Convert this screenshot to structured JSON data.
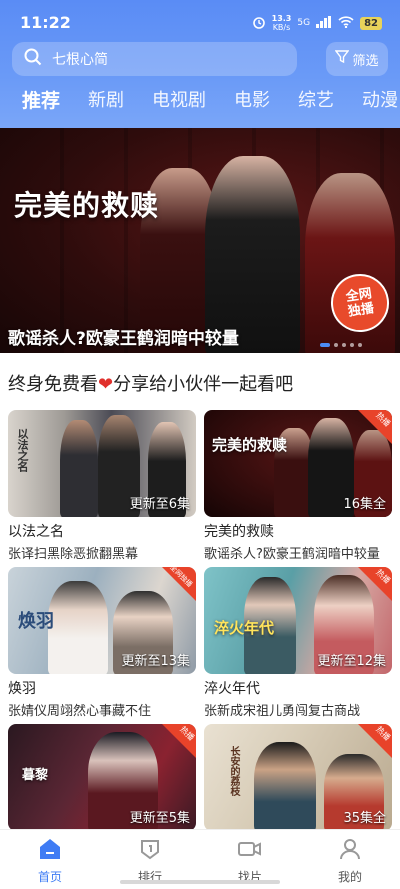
{
  "status_bar": {
    "time": "11:22",
    "speed_value": "13.3",
    "speed_unit": "KB/s",
    "network": "5G",
    "battery": "82"
  },
  "search": {
    "placeholder": "七根心简",
    "filter_label": "筛选"
  },
  "tabs": [
    {
      "label": "推荐",
      "active": true
    },
    {
      "label": "新剧",
      "active": false
    },
    {
      "label": "电视剧",
      "active": false
    },
    {
      "label": "电影",
      "active": false
    },
    {
      "label": "综艺",
      "active": false
    },
    {
      "label": "动漫",
      "active": false
    }
  ],
  "banner": {
    "logo_text": "完美的救赎",
    "caption": "歌谣杀人?欧豪王鹤润暗中较量",
    "badge_line1": "全网",
    "badge_line2": "独播",
    "slide_count": 5,
    "active_slide": 0
  },
  "share_text": "终身免费看",
  "share_text_2": "分享给小伙伴一起看吧",
  "cards": [
    {
      "title": "以法之名",
      "subtitle": "张译扫黑除恶掀翻黑幕",
      "episode": "更新至6集",
      "corner": "",
      "logo": "以法之名"
    },
    {
      "title": "完美的救赎",
      "subtitle": "歌谣杀人?欧豪王鹤润暗中较量",
      "episode": "16集全",
      "corner": "热播",
      "logo": "完美的救赎"
    },
    {
      "title": "焕羽",
      "subtitle": "张婧仪周翊然心事藏不住",
      "episode": "更新至13集",
      "corner": "全网独播",
      "logo": "焕羽"
    },
    {
      "title": "淬火年代",
      "subtitle": "张新成宋祖儿勇闯复古商战",
      "episode": "更新至12集",
      "corner": "热播",
      "logo": "淬火年代"
    },
    {
      "title": "",
      "subtitle": "",
      "episode": "更新至5集",
      "corner": "热播",
      "logo": "暮黎"
    },
    {
      "title": "",
      "subtitle": "",
      "episode": "35集全",
      "corner": "热播",
      "logo": "长安的荔枝"
    }
  ],
  "nav": [
    {
      "label": "首页",
      "icon": "home-icon",
      "active": true
    },
    {
      "label": "排行",
      "icon": "rank-icon",
      "active": false
    },
    {
      "label": "找片",
      "icon": "video-camera-icon",
      "active": false
    },
    {
      "label": "我的",
      "icon": "person-icon",
      "active": false
    }
  ],
  "colors": {
    "accent": "#3f7cf4",
    "header_gradient_top": "#5a8cf5",
    "badge_red": "#e84a2b",
    "battery": "#e8d35a"
  }
}
